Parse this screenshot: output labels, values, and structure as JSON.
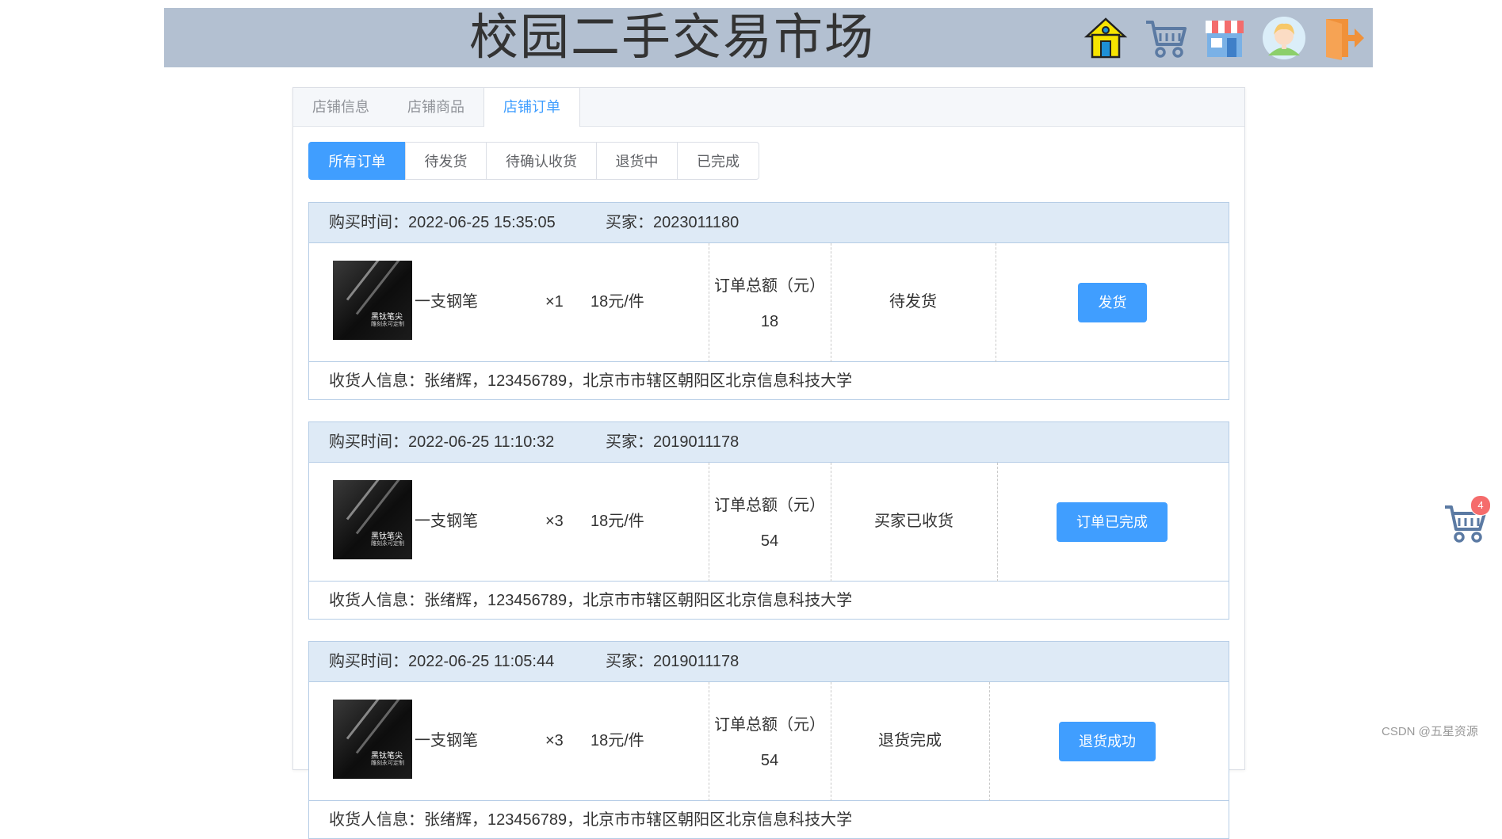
{
  "header": {
    "title": "校园二手交易市场",
    "icons": [
      "home-icon",
      "cart-icon",
      "store-icon",
      "avatar-icon",
      "logout-icon"
    ]
  },
  "tabs": [
    {
      "label": "店铺信息"
    },
    {
      "label": "店铺商品"
    },
    {
      "label": "店铺订单"
    }
  ],
  "active_tab": "店铺订单",
  "filters": [
    {
      "label": "所有订单"
    },
    {
      "label": "待发货"
    },
    {
      "label": "待确认收货"
    },
    {
      "label": "退货中"
    },
    {
      "label": "已完成"
    }
  ],
  "active_filter": "所有订单",
  "orders": [
    {
      "time": "购买时间：2022-06-25 15:35:05",
      "buyer": "买家：2023011180",
      "thumb_title": "黑钛笔尖",
      "thumb_sub": "雕刻永可定制",
      "product": "一支钢笔",
      "qty": "×1",
      "price": "18元/件",
      "total_label": "订单总额（元）",
      "total": "18",
      "status": "待发货",
      "action": "发货",
      "receiver": "收货人信息：张绪辉，123456789，北京市市辖区朝阳区北京信息科技大学"
    },
    {
      "time": "购买时间：2022-06-25 11:10:32",
      "buyer": "买家：2019011178",
      "thumb_title": "黑钛笔尖",
      "thumb_sub": "雕刻永可定制",
      "product": "一支钢笔",
      "qty": "×3",
      "price": "18元/件",
      "total_label": "订单总额（元）",
      "total": "54",
      "status": "买家已收货",
      "action": "订单已完成",
      "receiver": "收货人信息：张绪辉，123456789，北京市市辖区朝阳区北京信息科技大学"
    },
    {
      "time": "购买时间：2022-06-25 11:05:44",
      "buyer": "买家：2019011178",
      "thumb_title": "黑钛笔尖",
      "thumb_sub": "雕刻永可定制",
      "product": "一支钢笔",
      "qty": "×3",
      "price": "18元/件",
      "total_label": "订单总额（元）",
      "total": "54",
      "status": "退货完成",
      "action": "退货成功",
      "receiver": "收货人信息：张绪辉，123456789，北京市市辖区朝阳区北京信息科技大学"
    }
  ],
  "cart_badge": "4",
  "watermark": "CSDN @五星资源",
  "colors": {
    "header_bg": "#b3c0d1",
    "primary": "#409eff",
    "order_head_bg": "#deeaf6",
    "order_border": "#b6cde6",
    "badge": "#f56c6c"
  }
}
